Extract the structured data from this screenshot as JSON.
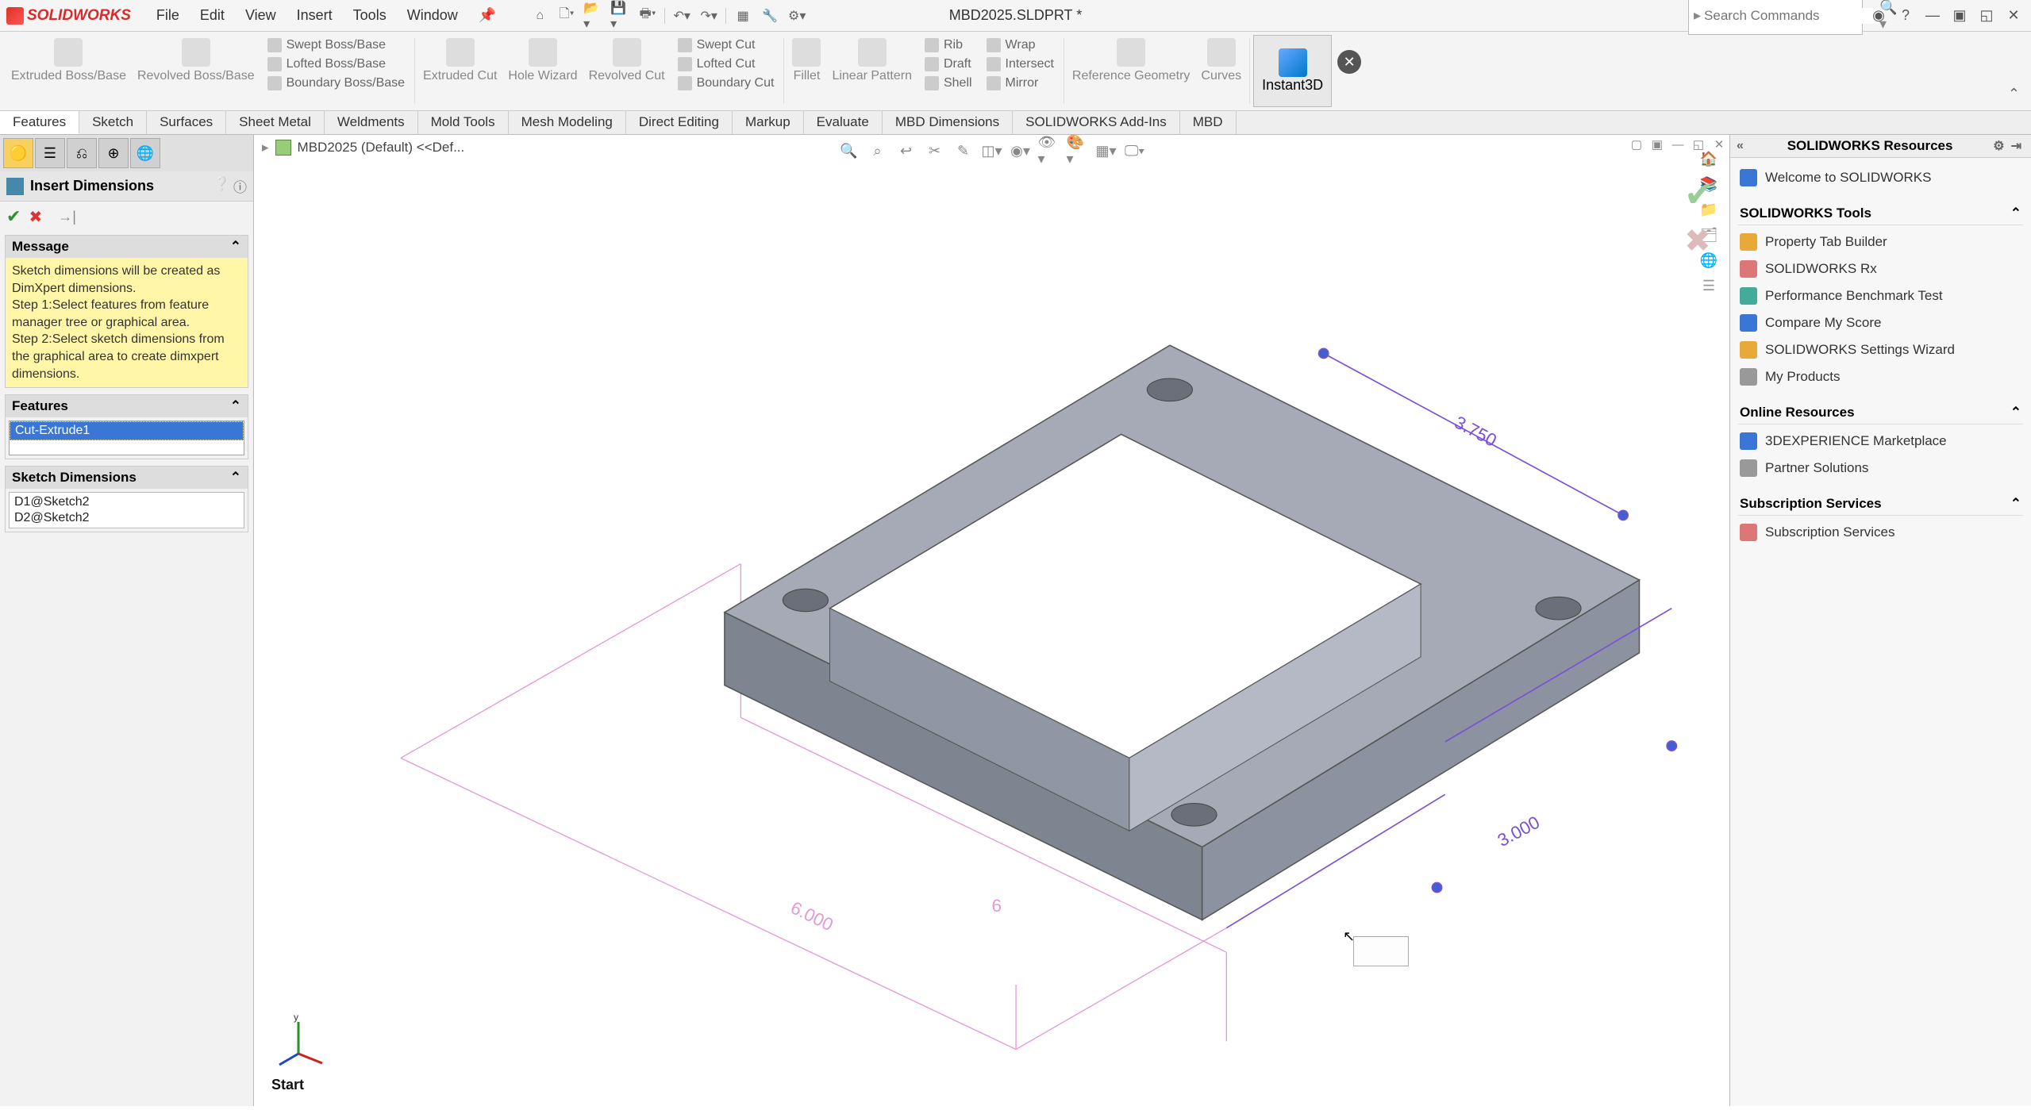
{
  "app": {
    "name": "SOLIDWORKS",
    "doc_title": "MBD2025.SLDPRT *"
  },
  "menus": [
    "File",
    "Edit",
    "View",
    "Insert",
    "Tools",
    "Window"
  ],
  "search_placeholder": "Search Commands",
  "ribbon": {
    "big": {
      "extruded_boss": "Extruded\nBoss/Base",
      "revolved_boss": "Revolved\nBoss/Base",
      "extruded_cut": "Extruded\nCut",
      "hole_wizard": "Hole\nWizard",
      "revolved_cut": "Revolved\nCut",
      "fillet": "Fillet",
      "linear_pattern": "Linear\nPattern",
      "ref_geom": "Reference\nGeometry",
      "curves": "Curves",
      "instant3d": "Instant3D"
    },
    "small1": {
      "swept": "Swept Boss/Base",
      "lofted": "Lofted Boss/Base",
      "boundary": "Boundary Boss/Base"
    },
    "small2": {
      "swept_cut": "Swept Cut",
      "lofted_cut": "Lofted Cut",
      "boundary_cut": "Boundary Cut"
    },
    "small3": {
      "rib": "Rib",
      "draft": "Draft",
      "shell": "Shell"
    },
    "small4": {
      "wrap": "Wrap",
      "intersect": "Intersect",
      "mirror": "Mirror"
    }
  },
  "tabs": [
    "Features",
    "Sketch",
    "Surfaces",
    "Sheet Metal",
    "Weldments",
    "Mold Tools",
    "Mesh Modeling",
    "Direct Editing",
    "Markup",
    "Evaluate",
    "MBD Dimensions",
    "SOLIDWORKS Add-Ins",
    "MBD"
  ],
  "breadcrumb": "MBD2025 (Default) <<Def...",
  "pm": {
    "title": "Insert Dimensions",
    "message_hdr": "Message",
    "message": "Sketch dimensions will be created as DimXpert dimensions.\nStep 1:Select features from feature manager tree or graphical area.\nStep 2:Select sketch dimensions from the graphical area to create dimxpert dimensions.",
    "features_hdr": "Features",
    "feature_item": "Cut-Extrude1",
    "sketchdim_hdr": "Sketch Dimensions",
    "dims": [
      "D1@Sketch2",
      "D2@Sketch2"
    ]
  },
  "gfx": {
    "start": "Start",
    "dim_a": "3.750",
    "dim_b": "3.000",
    "dim_c": "6.000",
    "dim_d": "6"
  },
  "taskpane": {
    "title": "SOLIDWORKS Resources",
    "welcome": "Welcome to SOLIDWORKS",
    "tools_hdr": "SOLIDWORKS Tools",
    "tools": [
      "Property Tab Builder",
      "SOLIDWORKS Rx",
      "Performance Benchmark Test",
      "Compare My Score",
      "SOLIDWORKS Settings Wizard",
      "My Products"
    ],
    "online_hdr": "Online Resources",
    "online": [
      "3DEXPERIENCE Marketplace",
      "Partner Solutions"
    ],
    "sub_hdr": "Subscription Services",
    "sub": [
      "Subscription Services"
    ]
  }
}
